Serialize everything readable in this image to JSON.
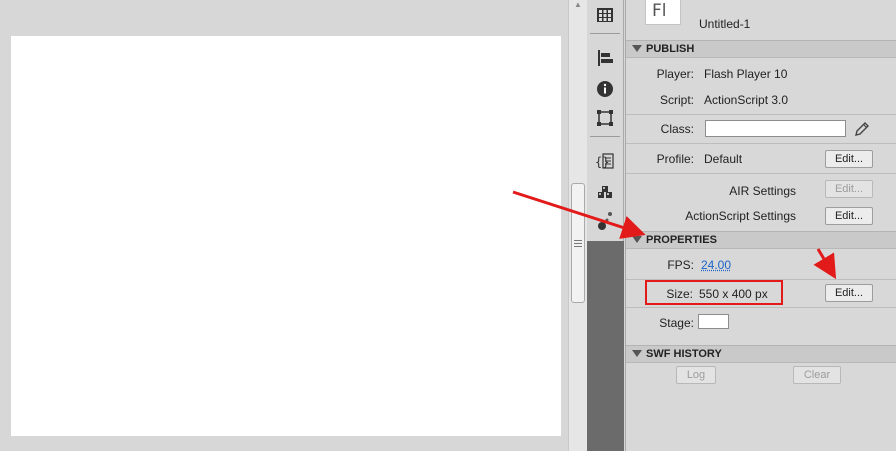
{
  "document": {
    "thumb_text": "Fl",
    "name": "Untitled-1"
  },
  "publish": {
    "header": "PUBLISH",
    "player_label": "Player:",
    "player_value": "Flash Player 10",
    "script_label": "Script:",
    "script_value": "ActionScript 3.0",
    "class_label": "Class:",
    "class_value": "",
    "profile_label": "Profile:",
    "profile_value": "Default",
    "profile_edit": "Edit...",
    "air_label": "AIR Settings",
    "air_edit": "Edit...",
    "as_label": "ActionScript Settings",
    "as_edit": "Edit..."
  },
  "properties": {
    "header": "PROPERTIES",
    "fps_label": "FPS:",
    "fps_value": "24.00",
    "size_label": "Size:",
    "size_value": "550 x 400 px",
    "size_edit": "Edit...",
    "stage_label": "Stage:",
    "stage_color": "#ffffff"
  },
  "swf_history": {
    "header": "SWF HISTORY",
    "log": "Log",
    "clear": "Clear"
  },
  "colors": {
    "annotation": "#e21a1a",
    "toolbar": "#6b6b6b",
    "link": "#1b63c9"
  },
  "tools": [
    "swatches-grid-icon",
    "align-icon",
    "info-icon",
    "transform-icon",
    "actions-script-icon",
    "components-icon",
    "motion-presets-icon"
  ]
}
